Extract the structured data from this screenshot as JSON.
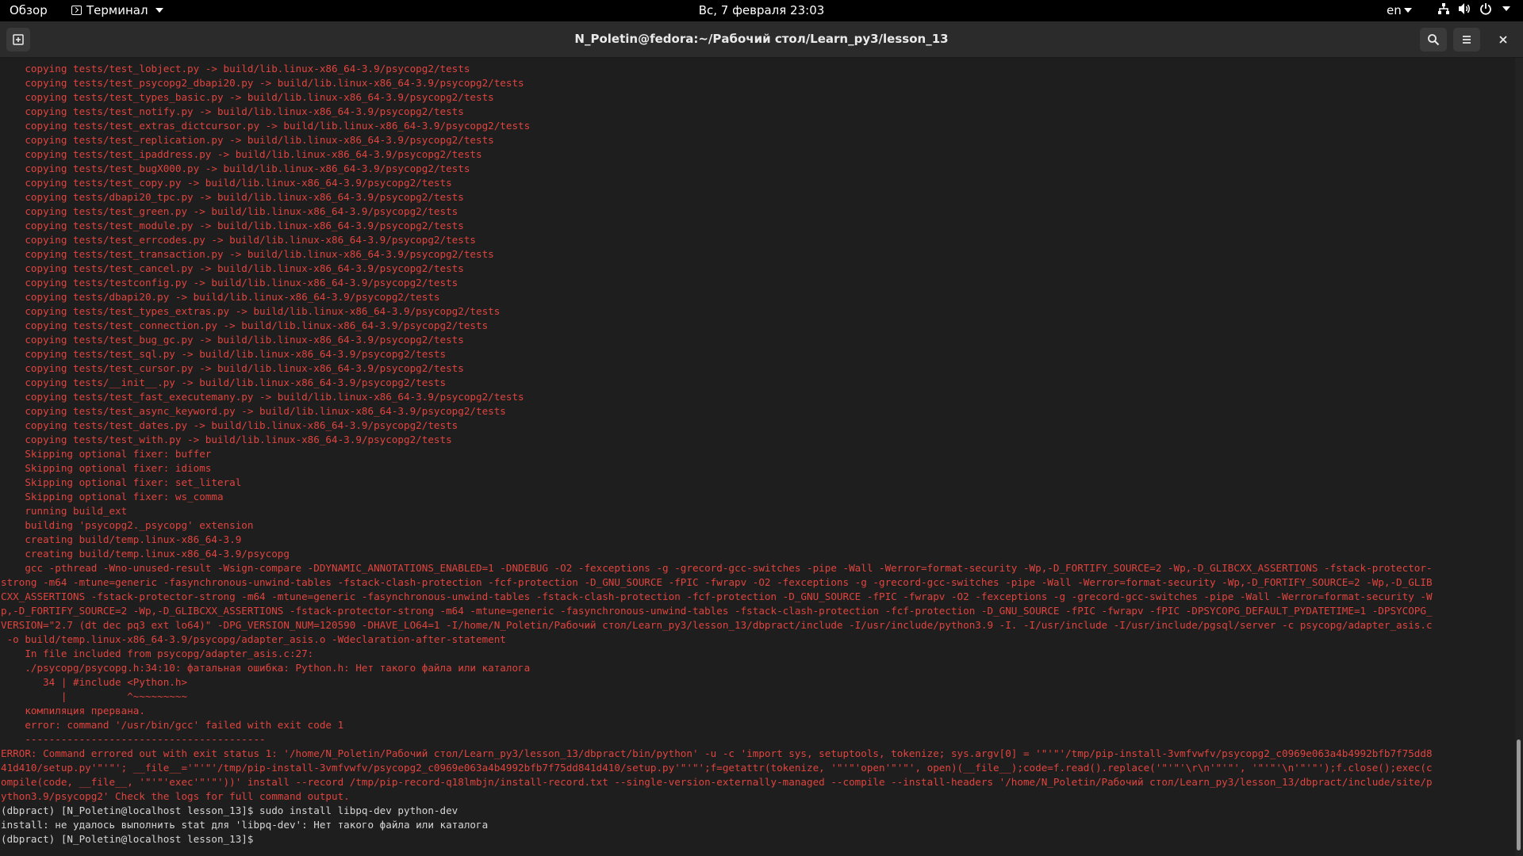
{
  "topbar": {
    "activities": "Обзор",
    "app_name": "Терминал",
    "clock": "Вс, 7 февраля  23:03",
    "lang": "en"
  },
  "window": {
    "title": "N_Poletin@fedora:~/Рабочий стол/Learn_py3/lesson_13"
  },
  "terminal": {
    "lines": [
      {
        "t": "    copying tests/test_lobject.py -> build/lib.linux-x86_64-3.9/psycopg2/tests",
        "c": "err"
      },
      {
        "t": "    copying tests/test_psycopg2_dbapi20.py -> build/lib.linux-x86_64-3.9/psycopg2/tests",
        "c": "err"
      },
      {
        "t": "    copying tests/test_types_basic.py -> build/lib.linux-x86_64-3.9/psycopg2/tests",
        "c": "err"
      },
      {
        "t": "    copying tests/test_notify.py -> build/lib.linux-x86_64-3.9/psycopg2/tests",
        "c": "err"
      },
      {
        "t": "    copying tests/test_extras_dictcursor.py -> build/lib.linux-x86_64-3.9/psycopg2/tests",
        "c": "err"
      },
      {
        "t": "    copying tests/test_replication.py -> build/lib.linux-x86_64-3.9/psycopg2/tests",
        "c": "err"
      },
      {
        "t": "    copying tests/test_ipaddress.py -> build/lib.linux-x86_64-3.9/psycopg2/tests",
        "c": "err"
      },
      {
        "t": "    copying tests/test_bugX000.py -> build/lib.linux-x86_64-3.9/psycopg2/tests",
        "c": "err"
      },
      {
        "t": "    copying tests/test_copy.py -> build/lib.linux-x86_64-3.9/psycopg2/tests",
        "c": "err"
      },
      {
        "t": "    copying tests/dbapi20_tpc.py -> build/lib.linux-x86_64-3.9/psycopg2/tests",
        "c": "err"
      },
      {
        "t": "    copying tests/test_green.py -> build/lib.linux-x86_64-3.9/psycopg2/tests",
        "c": "err"
      },
      {
        "t": "    copying tests/test_module.py -> build/lib.linux-x86_64-3.9/psycopg2/tests",
        "c": "err"
      },
      {
        "t": "    copying tests/test_errcodes.py -> build/lib.linux-x86_64-3.9/psycopg2/tests",
        "c": "err"
      },
      {
        "t": "    copying tests/test_transaction.py -> build/lib.linux-x86_64-3.9/psycopg2/tests",
        "c": "err"
      },
      {
        "t": "    copying tests/test_cancel.py -> build/lib.linux-x86_64-3.9/psycopg2/tests",
        "c": "err"
      },
      {
        "t": "    copying tests/testconfig.py -> build/lib.linux-x86_64-3.9/psycopg2/tests",
        "c": "err"
      },
      {
        "t": "    copying tests/dbapi20.py -> build/lib.linux-x86_64-3.9/psycopg2/tests",
        "c": "err"
      },
      {
        "t": "    copying tests/test_types_extras.py -> build/lib.linux-x86_64-3.9/psycopg2/tests",
        "c": "err"
      },
      {
        "t": "    copying tests/test_connection.py -> build/lib.linux-x86_64-3.9/psycopg2/tests",
        "c": "err"
      },
      {
        "t": "    copying tests/test_bug_gc.py -> build/lib.linux-x86_64-3.9/psycopg2/tests",
        "c": "err"
      },
      {
        "t": "    copying tests/test_sql.py -> build/lib.linux-x86_64-3.9/psycopg2/tests",
        "c": "err"
      },
      {
        "t": "    copying tests/test_cursor.py -> build/lib.linux-x86_64-3.9/psycopg2/tests",
        "c": "err"
      },
      {
        "t": "    copying tests/__init__.py -> build/lib.linux-x86_64-3.9/psycopg2/tests",
        "c": "err"
      },
      {
        "t": "    copying tests/test_fast_executemany.py -> build/lib.linux-x86_64-3.9/psycopg2/tests",
        "c": "err"
      },
      {
        "t": "    copying tests/test_async_keyword.py -> build/lib.linux-x86_64-3.9/psycopg2/tests",
        "c": "err"
      },
      {
        "t": "    copying tests/test_dates.py -> build/lib.linux-x86_64-3.9/psycopg2/tests",
        "c": "err"
      },
      {
        "t": "    copying tests/test_with.py -> build/lib.linux-x86_64-3.9/psycopg2/tests",
        "c": "err"
      },
      {
        "t": "    Skipping optional fixer: buffer",
        "c": "err"
      },
      {
        "t": "    Skipping optional fixer: idioms",
        "c": "err"
      },
      {
        "t": "    Skipping optional fixer: set_literal",
        "c": "err"
      },
      {
        "t": "    Skipping optional fixer: ws_comma",
        "c": "err"
      },
      {
        "t": "    running build_ext",
        "c": "err"
      },
      {
        "t": "    building 'psycopg2._psycopg' extension",
        "c": "err"
      },
      {
        "t": "    creating build/temp.linux-x86_64-3.9",
        "c": "err"
      },
      {
        "t": "    creating build/temp.linux-x86_64-3.9/psycopg",
        "c": "err"
      },
      {
        "t": "    gcc -pthread -Wno-unused-result -Wsign-compare -DDYNAMIC_ANNOTATIONS_ENABLED=1 -DNDEBUG -O2 -fexceptions -g -grecord-gcc-switches -pipe -Wall -Werror=format-security -Wp,-D_FORTIFY_SOURCE=2 -Wp,-D_GLIBCXX_ASSERTIONS -fstack-protector-",
        "c": "err"
      },
      {
        "t": "strong -m64 -mtune=generic -fasynchronous-unwind-tables -fstack-clash-protection -fcf-protection -D_GNU_SOURCE -fPIC -fwrapv -O2 -fexceptions -g -grecord-gcc-switches -pipe -Wall -Werror=format-security -Wp,-D_FORTIFY_SOURCE=2 -Wp,-D_GLIB",
        "c": "err"
      },
      {
        "t": "CXX_ASSERTIONS -fstack-protector-strong -m64 -mtune=generic -fasynchronous-unwind-tables -fstack-clash-protection -fcf-protection -D_GNU_SOURCE -fPIC -fwrapv -O2 -fexceptions -g -grecord-gcc-switches -pipe -Wall -Werror=format-security -W",
        "c": "err"
      },
      {
        "t": "p,-D_FORTIFY_SOURCE=2 -Wp,-D_GLIBCXX_ASSERTIONS -fstack-protector-strong -m64 -mtune=generic -fasynchronous-unwind-tables -fstack-clash-protection -fcf-protection -D_GNU_SOURCE -fPIC -fwrapv -fPIC -DPSYCOPG_DEFAULT_PYDATETIME=1 -DPSYCOPG_",
        "c": "err"
      },
      {
        "t": "VERSION=\"2.7 (dt dec pq3 ext lo64)\" -DPG_VERSION_NUM=120590 -DHAVE_LO64=1 -I/home/N_Poletin/Рабочий стол/Learn_py3/lesson_13/dbpract/include -I/usr/include/python3.9 -I. -I/usr/include -I/usr/include/pgsql/server -c psycopg/adapter_asis.c",
        "c": "err"
      },
      {
        "t": " -o build/temp.linux-x86_64-3.9/psycopg/adapter_asis.o -Wdeclaration-after-statement",
        "c": "err"
      },
      {
        "t": "    In file included from psycopg/adapter_asis.c:27:",
        "c": "err"
      },
      {
        "t": "    ./psycopg/psycopg.h:34:10: фатальная ошибка: Python.h: Нет такого файла или каталога",
        "c": "err"
      },
      {
        "t": "       34 | #include <Python.h>",
        "c": "err"
      },
      {
        "t": "          |          ^~~~~~~~~~",
        "c": "err"
      },
      {
        "t": "    компиляция прервана.",
        "c": "err"
      },
      {
        "t": "    error: command '/usr/bin/gcc' failed with exit code 1",
        "c": "err"
      },
      {
        "t": "    ----------------------------------------",
        "c": "err"
      },
      {
        "t": "ERROR: Command errored out with exit status 1: '/home/N_Poletin/Рабочий стол/Learn_py3/lesson_13/dbpract/bin/python' -u -c 'import sys, setuptools, tokenize; sys.argv[0] = '\"'\"'/tmp/pip-install-3vmfvwfv/psycopg2_c0969e063a4b4992bfb7f75dd8",
        "c": "err"
      },
      {
        "t": "41d410/setup.py'\"'\"'; __file__='\"'\"'/tmp/pip-install-3vmfvwfv/psycopg2_c0969e063a4b4992bfb7f75dd841d410/setup.py'\"'\"';f=getattr(tokenize, '\"'\"'open'\"'\"', open)(__file__);code=f.read().replace('\"'\"'\\r\\n'\"'\"', '\"'\"'\\n'\"'\"');f.close();exec(c",
        "c": "err"
      },
      {
        "t": "ompile(code, __file__, '\"'\"'exec'\"'\"'))' install --record /tmp/pip-record-q18lmbjn/install-record.txt --single-version-externally-managed --compile --install-headers '/home/N_Poletin/Рабочий стол/Learn_py3/lesson_13/dbpract/include/site/p",
        "c": "err"
      },
      {
        "t": "ython3.9/psycopg2' Check the logs for full command output.",
        "c": "err"
      },
      {
        "t": "(dbpract) [N_Poletin@localhost lesson_13]$ sudo install libpq-dev python-dev",
        "c": "std"
      },
      {
        "t": "install: не удалось выполнить stat для 'libpq-dev': Нет такого файла или каталога",
        "c": "std"
      },
      {
        "t": "(dbpract) [N_Poletin@localhost lesson_13]$ ",
        "c": "std"
      }
    ]
  },
  "colors": {
    "error_text": "#e0443e",
    "normal_text": "#d6d6d6",
    "background": "#1e1e1e"
  },
  "icons": [
    "terminal-app-icon",
    "new-tab-icon",
    "search-icon",
    "hamburger-menu-icon",
    "close-icon",
    "network-icon",
    "volume-icon",
    "power-icon"
  ]
}
